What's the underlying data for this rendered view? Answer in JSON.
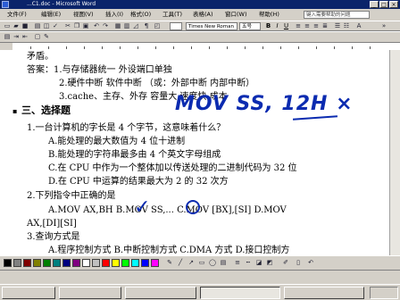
{
  "window": {
    "title": "...C1.doc - Microsoft Word",
    "min_glyph": "_",
    "max_glyph": "□",
    "close_glyph": "×"
  },
  "menu": {
    "items": [
      "文件(F)",
      "编辑(E)",
      "视图(V)",
      "插入(I)",
      "格式(O)",
      "工具(T)",
      "表格(A)",
      "窗口(W)",
      "帮助(H)"
    ],
    "help_placeholder": "键入需要帮助的问题"
  },
  "format": {
    "font": "Times New Roman",
    "size": "五号",
    "bold": "B",
    "italic": "I",
    "underline": "U"
  },
  "doc": {
    "l1": "矛盾。",
    "l2": "答案：1.与存储器统一        外设端口单独",
    "l3": "2.硬件中断  软件中断  （或：外部中断  内部中断）",
    "l4": "3.cache、主存、外存     容量大   速度快   成本",
    "bullet": "▪",
    "sec": "三、选择题",
    "q1": "1.一台计算机的字长是 4 个字节，这意味着什么？",
    "q1a": "A.能处理的最大数值为 4 位十进制",
    "q1b": "B.能处理的字符串最多由 4 个英文字母组成",
    "q1c": "C.在 CPU 中作为一个整体加以传送处理的二进制代码为 32 位",
    "q1d": "D.在 CPU 中运算的结果最大为 2 的 32 次方",
    "q2": "2.下列指令中正确的是",
    "q2opts": "A.MOV AX,BH    B.MOV SS,...    C.MOV [BX],[SI]    D.MOV",
    "q2d2": "AX,[DI][SI]",
    "q3": "3.查询方式是",
    "q3opts": "A.程序控制方式   B.中断控制方式   C.DMA 方式  D.接口控制方"
  },
  "annotations": {
    "handwriting": "MOV SS, 12H ×",
    "check": "✓"
  },
  "colors": {
    "ink": "#0b2bb0",
    "title_bar": "#0a246a",
    "palette": [
      "#000000",
      "#808080",
      "#800000",
      "#808000",
      "#008000",
      "#008080",
      "#000080",
      "#800080",
      "#ffffff",
      "#c0c0c0",
      "#ff0000",
      "#ffff00",
      "#00ff00",
      "#00ffff",
      "#0000ff",
      "#ff00ff"
    ]
  },
  "taskbar": {
    "items": [
      "",
      "",
      "",
      "",
      ""
    ]
  }
}
